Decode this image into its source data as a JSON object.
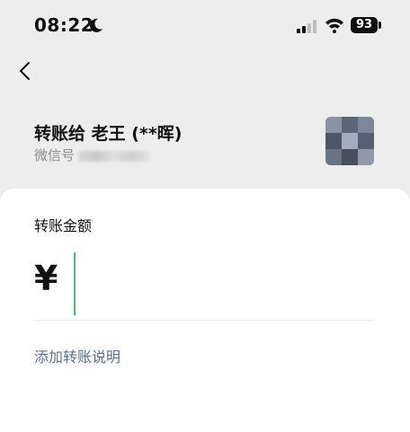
{
  "status_bar": {
    "time": "08:22",
    "battery": "93",
    "icons": [
      "moon-icon",
      "cellular-signal-icon",
      "wifi-icon",
      "battery-icon"
    ]
  },
  "nav": {
    "back_icon": "chevron-left-icon"
  },
  "payee": {
    "title": "转账给 老王 (**晖)",
    "wechat_label": "微信号",
    "avatar_icon": "avatar"
  },
  "transfer": {
    "amount_label": "转账金额",
    "currency_symbol": "¥",
    "amount_value": "",
    "add_note_label": "添加转账说明"
  },
  "colors": {
    "background": "#ededed",
    "card": "#ffffff",
    "caret": "#3ccb74",
    "link": "#5d6e8e"
  }
}
